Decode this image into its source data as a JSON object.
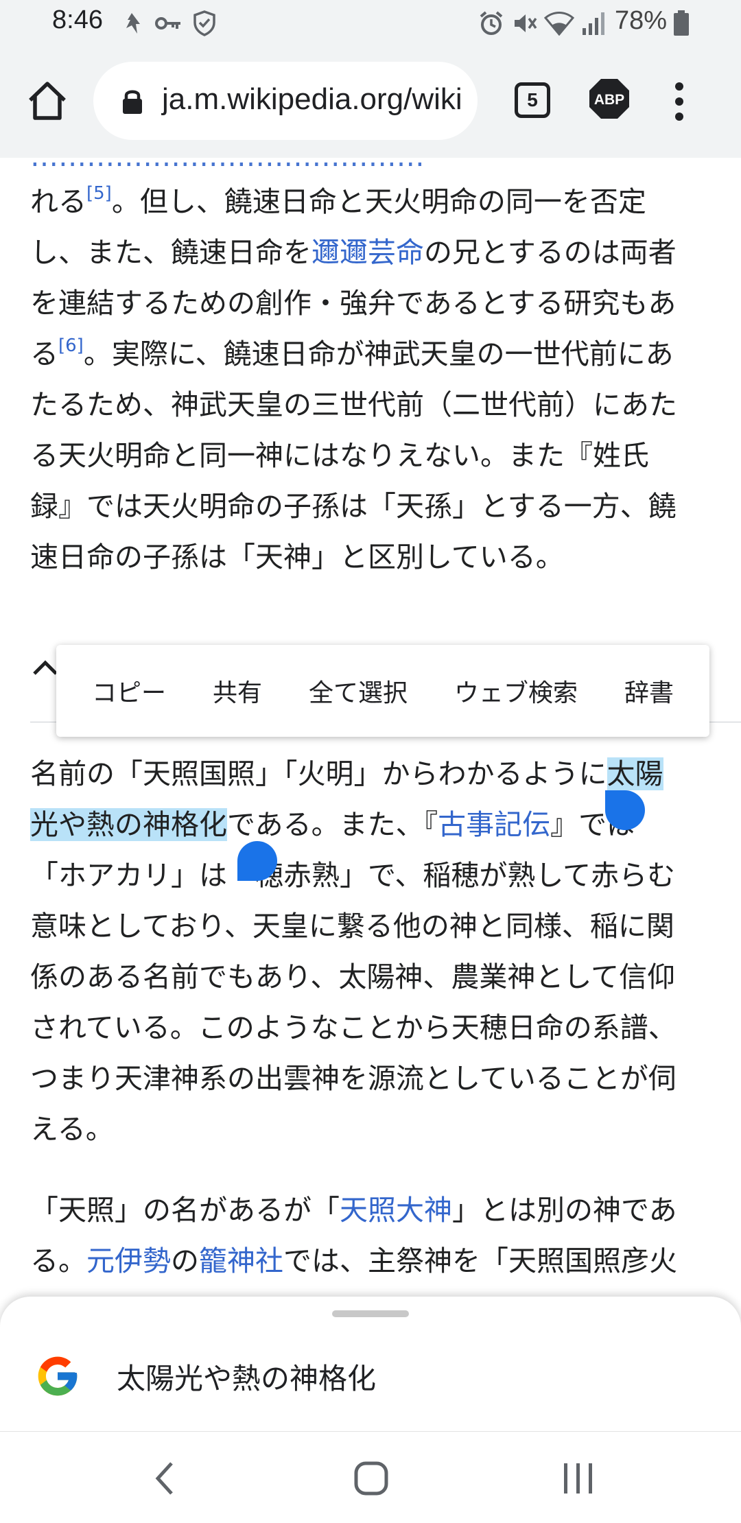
{
  "status_bar": {
    "time": "8:46",
    "battery_percent": "78%",
    "icons": [
      "notification-icon",
      "key-icon",
      "shield-icon",
      "alarm-icon",
      "mute-icon",
      "wifi-icon",
      "signal-icon",
      "battery-icon"
    ]
  },
  "browser": {
    "url": "ja.m.wikipedia.org/wiki",
    "tab_count": "5",
    "adblock_label": "ABP"
  },
  "article": {
    "para1": {
      "line1": "れる",
      "ref1": "[5]",
      "line1b": "。但し、饒速日命と天火明命の同一を否定",
      "line2a": "し、また、饒速日命を",
      "line2link": "邇邇芸命",
      "line2b": "の兄とするのは両者",
      "line3": "を連結するための創作・強弁であるとする研究もあ",
      "line4a": "る",
      "ref2": "[6]",
      "line4b": "。実際に、饒速日命が神武天皇の一世代前にあ",
      "line5": "たるため、神武天皇の三世代前（二世代前）にあた",
      "line6": "る天火明命と同一神にはなりえない。また『姓氏",
      "line7": "録』では天火明命の子孫は「天孫」とする一方、饒",
      "line8": "速日命の子孫は「天神」と区別している。"
    },
    "para2": {
      "line1a": "名前の「天照国照」「火明」からわかるように",
      "line1sel": "太陽",
      "line2sel": "光や熱の神格化",
      "line2a": "である。また、『",
      "line2link": "古事記伝",
      "line2b": "』では",
      "line3": "「ホアカリ」は「穂赤熟」で、稲穂が熟して赤らむ",
      "line4": "意味としており、天皇に繋る他の神と同様、稲に関",
      "line5": "係のある名前でもあり、太陽神、農業神として信仰",
      "line6": "されている。このようなことから天穂日命の系譜、",
      "line7": "つまり天津神系の出雲神を源流としていることが伺",
      "line8": "える。"
    },
    "para3": {
      "line1a": "「天照」の名があるが「",
      "line1link": "天照大神",
      "line1b": "」とは別の神であ",
      "line2a": "る。",
      "line2link1": "元伊勢",
      "line2mid": "の",
      "line2link2": "籠神社",
      "line2b": "では、主祭神を「天照国照彦火"
    }
  },
  "context_menu": {
    "items": [
      "コピー",
      "共有",
      "全て選択",
      "ウェブ検索",
      "辞書"
    ]
  },
  "search_sheet": {
    "query": "太陽光や熱の神格化"
  },
  "nav_bar": {
    "icons": [
      "back-icon",
      "home-icon",
      "recents-icon"
    ]
  },
  "colors": {
    "link": "#3366cc",
    "selection_highlight": "#b9e2f8",
    "selection_handle": "#1a73e8",
    "toolbar_bg": "#f1f3f4"
  }
}
